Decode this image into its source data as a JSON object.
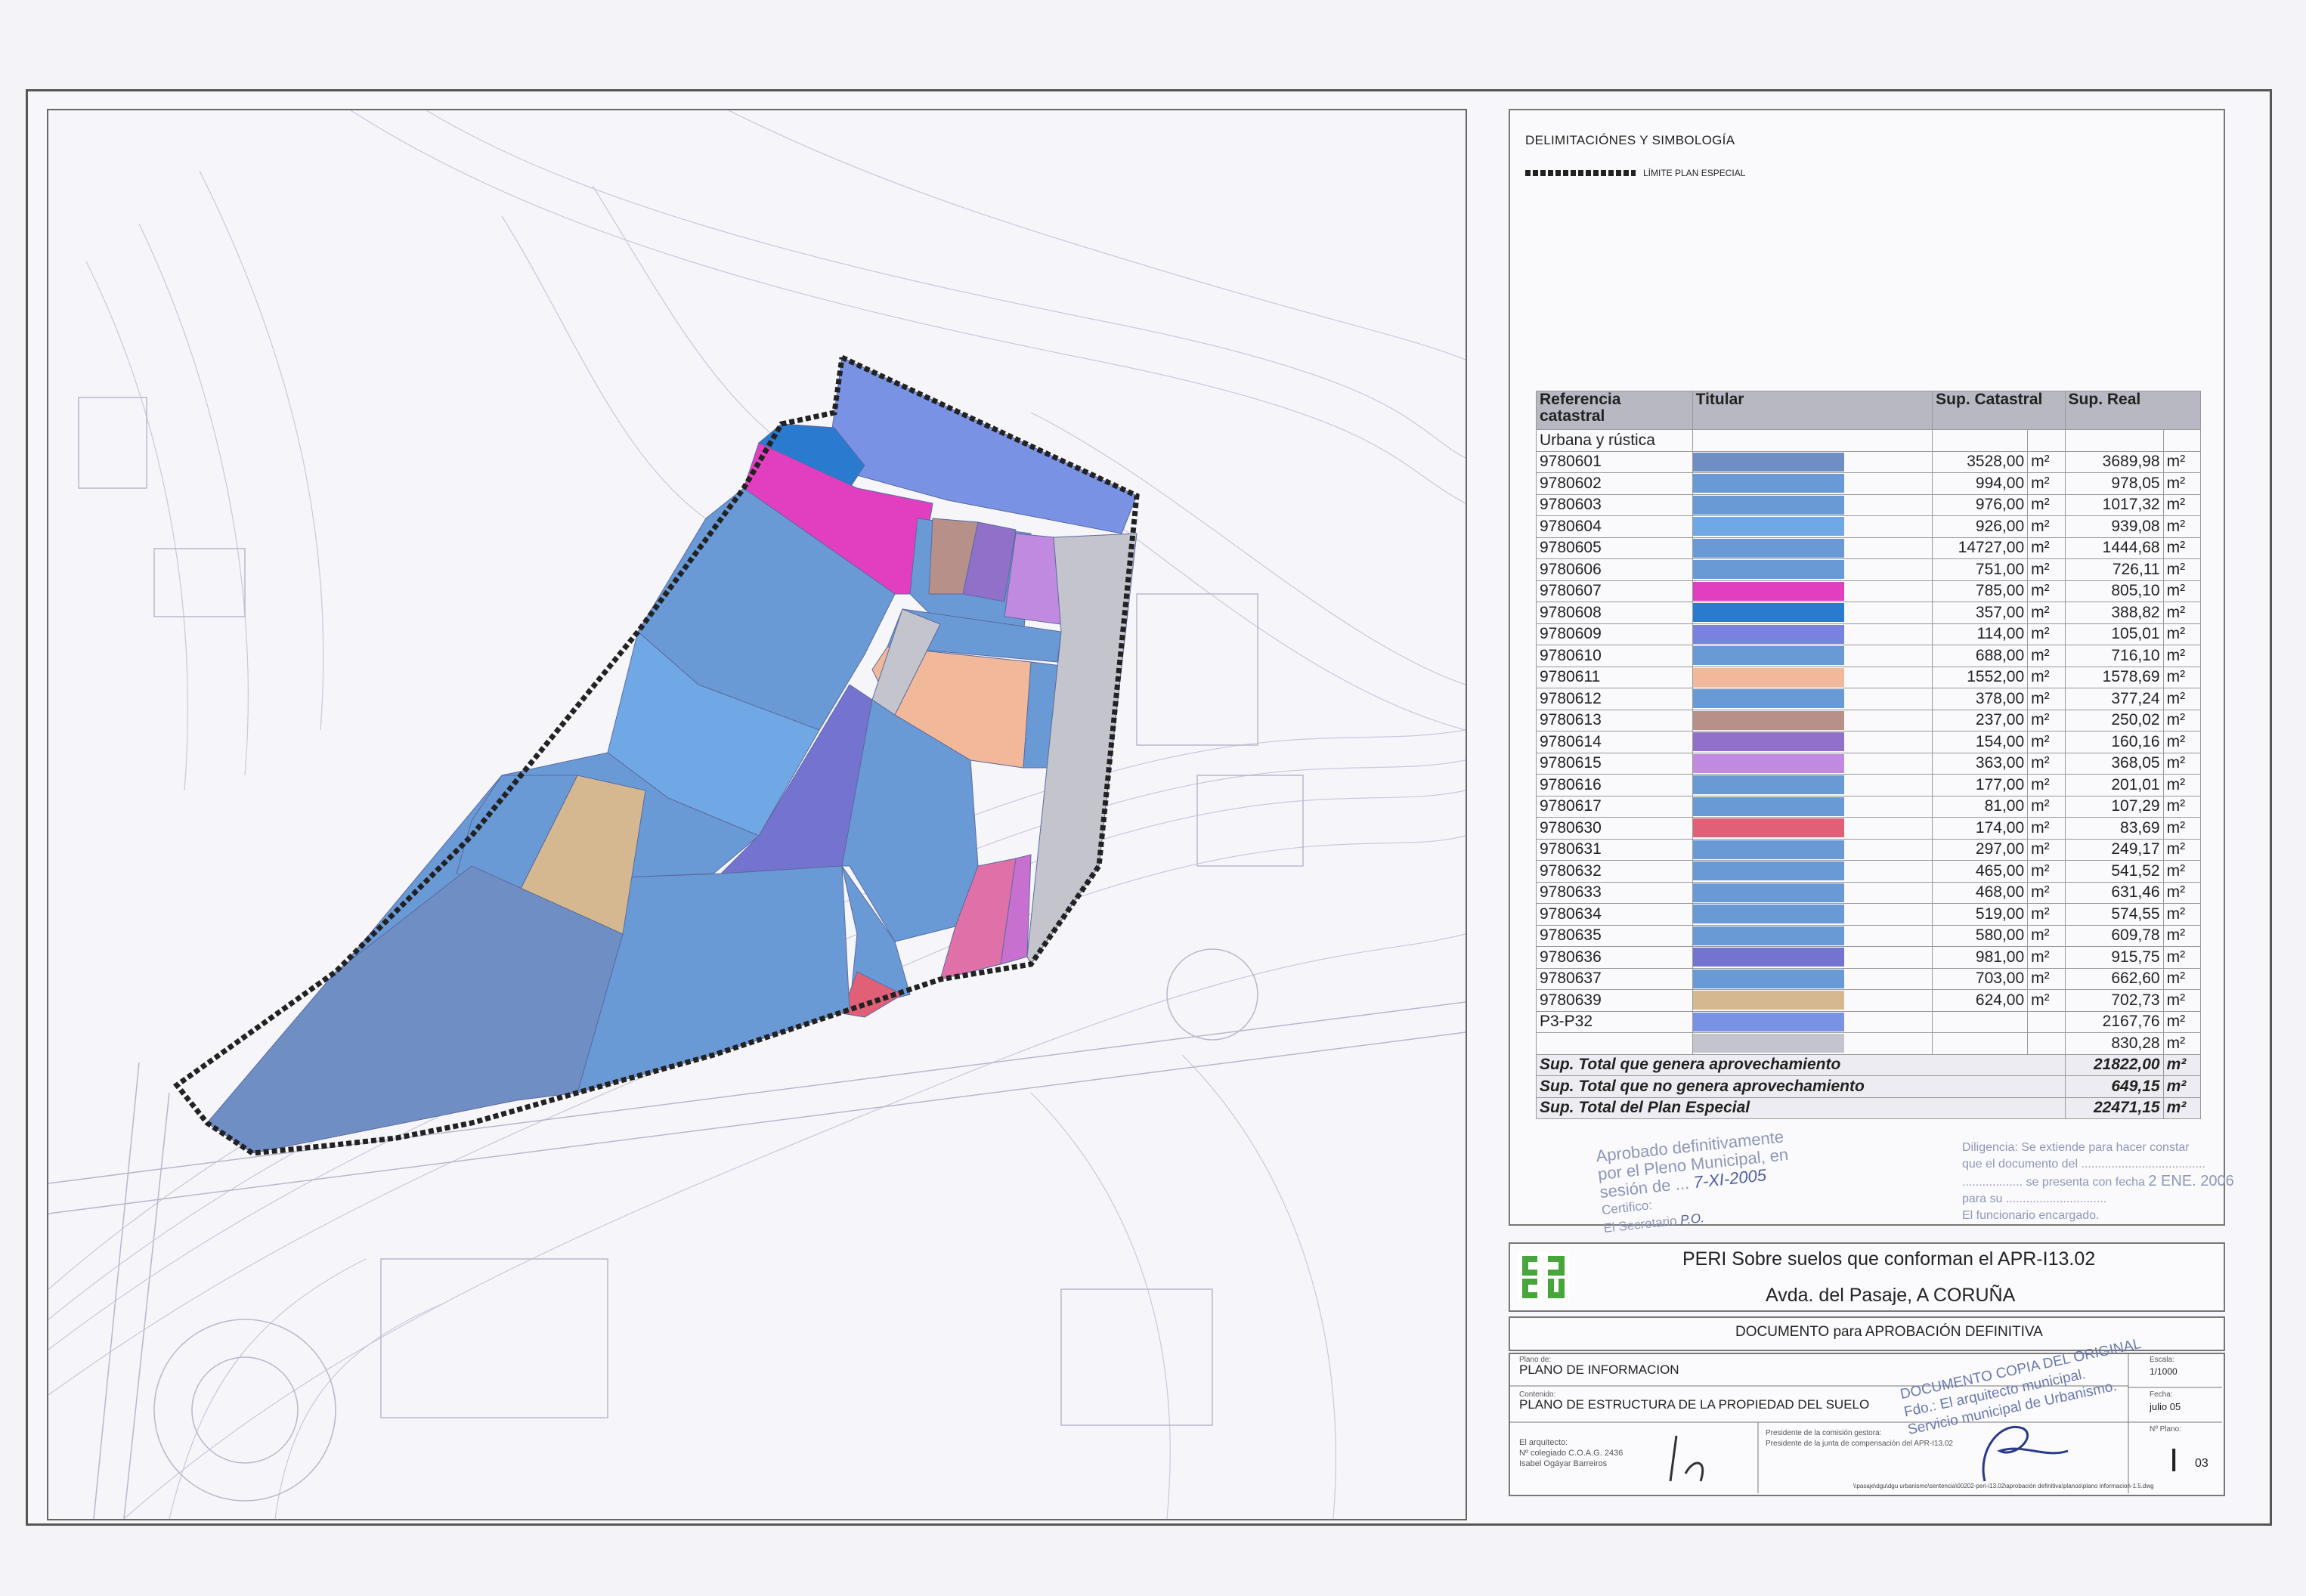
{
  "legend": {
    "title": "DELIMITACIÓNES Y SIMBOLOGÍA",
    "limit_label": "LÍMITE PLAN ESPECIAL"
  },
  "table": {
    "headers": [
      "Referencia catastral",
      "Titular",
      "Sup. Catastral",
      "Sup. Real"
    ],
    "section": "Urbana y rústica",
    "unit": "m²",
    "rows": [
      {
        "ref": "9780601",
        "color": "#6f8fc4",
        "cat": "3528,00",
        "real": "3689,98"
      },
      {
        "ref": "9780602",
        "color": "#6a9ad6",
        "cat": "994,00",
        "real": "978,05"
      },
      {
        "ref": "9780603",
        "color": "#6a9ad6",
        "cat": "976,00",
        "real": "1017,32"
      },
      {
        "ref": "9780604",
        "color": "#70a8e6",
        "cat": "926,00",
        "real": "939,08"
      },
      {
        "ref": "9780605",
        "color": "#6a9ad6",
        "cat": "14727,00",
        "real": "1444,68"
      },
      {
        "ref": "9780606",
        "color": "#6a9ad6",
        "cat": "751,00",
        "real": "726,11"
      },
      {
        "ref": "9780607",
        "color": "#e23fc0",
        "cat": "785,00",
        "real": "805,10"
      },
      {
        "ref": "9780608",
        "color": "#2a7ad0",
        "cat": "357,00",
        "real": "388,82"
      },
      {
        "ref": "9780609",
        "color": "#7a82e0",
        "cat": "114,00",
        "real": "105,01"
      },
      {
        "ref": "9780610",
        "color": "#6a9ad6",
        "cat": "688,00",
        "real": "716,10"
      },
      {
        "ref": "9780611",
        "color": "#f2b89a",
        "cat": "1552,00",
        "real": "1578,69"
      },
      {
        "ref": "9780612",
        "color": "#6a9ad6",
        "cat": "378,00",
        "real": "377,24"
      },
      {
        "ref": "9780613",
        "color": "#b8908a",
        "cat": "237,00",
        "real": "250,02"
      },
      {
        "ref": "9780614",
        "color": "#9070c8",
        "cat": "154,00",
        "real": "160,16"
      },
      {
        "ref": "9780615",
        "color": "#c08ae0",
        "cat": "363,00",
        "real": "368,05"
      },
      {
        "ref": "9780616",
        "color": "#6a9ad6",
        "cat": "177,00",
        "real": "201,01"
      },
      {
        "ref": "9780617",
        "color": "#6a9ad6",
        "cat": "81,00",
        "real": "107,29"
      },
      {
        "ref": "9780630",
        "color": "#e06078",
        "cat": "174,00",
        "real": "83,69"
      },
      {
        "ref": "9780631",
        "color": "#6a9ad6",
        "cat": "297,00",
        "real": "249,17"
      },
      {
        "ref": "9780632",
        "color": "#6a9ad6",
        "cat": "465,00",
        "real": "541,52"
      },
      {
        "ref": "9780633",
        "color": "#6a9ad6",
        "cat": "468,00",
        "real": "631,46"
      },
      {
        "ref": "9780634",
        "color": "#6a9ad6",
        "cat": "519,00",
        "real": "574,55"
      },
      {
        "ref": "9780635",
        "color": "#6a9ad6",
        "cat": "580,00",
        "real": "609,78"
      },
      {
        "ref": "9780636",
        "color": "#7474d0",
        "cat": "981,00",
        "real": "915,75"
      },
      {
        "ref": "9780637",
        "color": "#6a9ad6",
        "cat": "703,00",
        "real": "662,60"
      },
      {
        "ref": "9780639",
        "color": "#d6b890",
        "cat": "624,00",
        "real": "702,73"
      },
      {
        "ref": "P3-P32",
        "color": "#7a92e4",
        "cat": "",
        "real": "2167,76"
      },
      {
        "ref": "",
        "color": "#c4c4cc",
        "cat": "",
        "real": "830,28"
      }
    ],
    "totals": [
      {
        "label": "Sup. Total que genera aprovechamiento",
        "value": "21822,00"
      },
      {
        "label": "Sup. Total que no genera aprovechamiento",
        "value": "649,15"
      },
      {
        "label": "Sup. Total del Plan Especial",
        "value": "22471,15"
      }
    ]
  },
  "stamp_approval": {
    "line1": "Aprobado definitivamente",
    "line2": "por el Pleno Municipal, en",
    "line3": "sesión de",
    "date_handwritten": "7-XI-2005",
    "line4": "Certifico:",
    "line5": "El Secretario",
    "initials": "P.O."
  },
  "stamp_diligencia": {
    "line1": "Diligencia: Se extiende para hacer constar",
    "line2": "que el documento del",
    "line3": "se presenta con fecha",
    "line4": "para su",
    "line5": "El funcionario encargado.",
    "date": "2 ENE. 2006"
  },
  "title": {
    "line1": "PERI Sobre suelos que conforman el APR-I13.02",
    "line2": "Avda. del Pasaje,   A CORUÑA",
    "document": "DOCUMENTO para APROBACIÓN DEFINITIVA"
  },
  "info": {
    "plano_label": "Plano de:",
    "plano": "PLANO DE INFORMACION",
    "contenido_label": "Contenido:",
    "contenido": "PLANO DE ESTRUCTURA DE LA PROPIEDAD DEL SUELO",
    "arquitecto_label": "El arquitecto:",
    "arquitecto_num": "Nº colegiado C.O.A.G. 2436",
    "arquitecto_name": "Isabel Ogáyar Barreiros",
    "presidente_label": "Presidente de la comisión gestora:",
    "presidente": "Presidente de la junta de compensación del APR-I13.02",
    "escala_label": "Escala:",
    "escala": "1/1000",
    "fecha_label": "Fecha:",
    "fecha": "julio 05",
    "plano_num_label": "Nº Plano:",
    "plano_num": "I",
    "plano_of": "03",
    "copia_line1": "DOCUMENTO COPIA DEL ORIGINAL",
    "copia_line2": "Fdo.: El arquitecto municipal.",
    "copia_line3": "Servicio municipal de Urbanismo.",
    "path": "\\\\pasaje\\dgu\\dgu urbanismo\\sentencia\\00202-peri-i13.02\\aprobación definitiva\\planos\\plano informacion-1.5.dwg"
  },
  "colors": {
    "blue": "#6a9ad6",
    "border": "#555555"
  }
}
